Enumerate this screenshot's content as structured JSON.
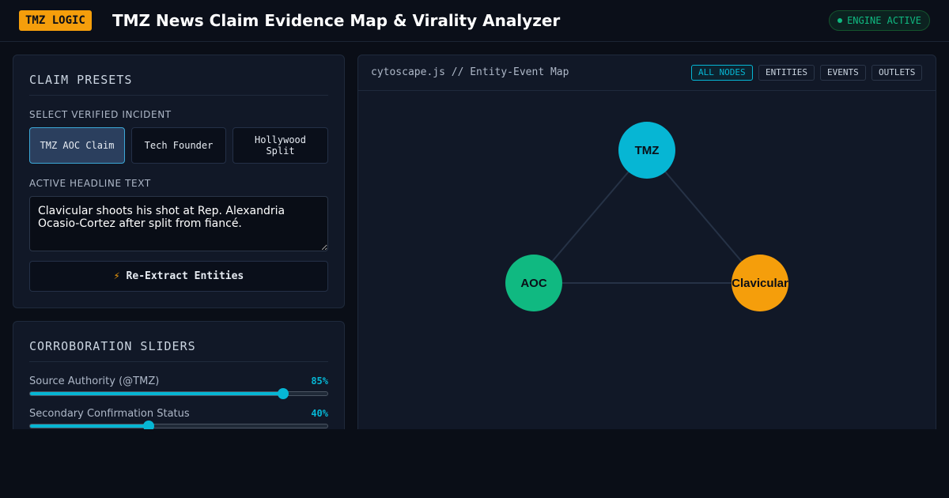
{
  "header": {
    "badge": "TMZ LOGIC",
    "title": "TMZ News Claim Evidence Map & Virality Analyzer",
    "status": "ENGINE ACTIVE"
  },
  "presets_panel": {
    "title": "CLAIM PRESETS",
    "select_label": "SELECT VERIFIED INCIDENT",
    "presets": [
      "TMZ AOC Claim",
      "Tech Founder",
      "Hollywood Split"
    ],
    "active_preset": "TMZ AOC Claim",
    "headline_label": "ACTIVE HEADLINE TEXT",
    "headline_text": "Clavicular shoots his shot at Rep. Alexandria Ocasio-Cortez after split from fiancé.",
    "extract_button": "Re-Extract Entities"
  },
  "sliders_panel": {
    "title": "CORROBORATION SLIDERS",
    "sliders": [
      {
        "label": "Source Authority (@TMZ)",
        "value_text": "85%",
        "value": 85
      },
      {
        "label": "Secondary Confirmation Status",
        "value_text": "40%",
        "value": 40
      }
    ]
  },
  "graph": {
    "title": "cytoscape.js // Entity-Event Map",
    "filters": [
      "ALL NODES",
      "ENTITIES",
      "EVENTS",
      "OUTLETS"
    ],
    "active_filter": "ALL NODES",
    "nodes": [
      {
        "label": "TMZ",
        "color": "#06b6d4"
      },
      {
        "label": "AOC",
        "color": "#10b981"
      },
      {
        "label": "Clavicular",
        "color": "#f59e0b"
      }
    ]
  },
  "colors": {
    "accent": "#06b6d4",
    "brand": "#f59e0b",
    "success": "#10b981",
    "background": "#0a0e17"
  }
}
